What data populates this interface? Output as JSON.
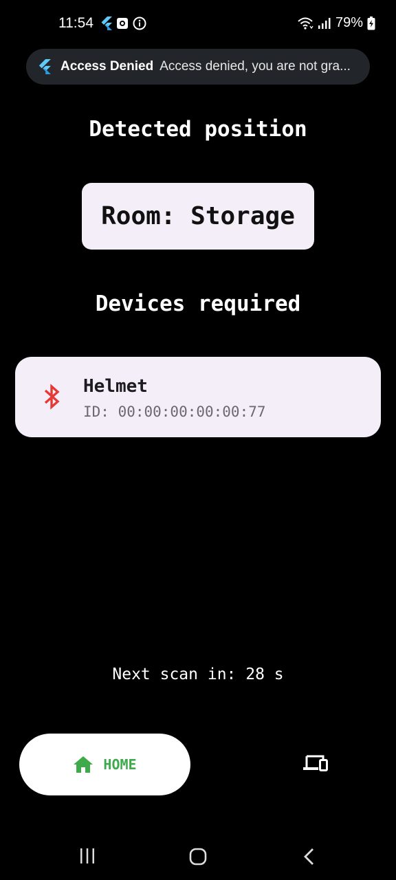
{
  "status_bar": {
    "time": "11:54",
    "battery": "79%",
    "left_icons": [
      "flutter-icon",
      "record-icon",
      "info-icon"
    ],
    "right_icons": [
      "wifi-icon",
      "signal-icon",
      "battery-charging-icon"
    ]
  },
  "notification": {
    "app_icon": "flutter-icon",
    "title": "Access Denied",
    "text": "Access denied, you are not gra..."
  },
  "position": {
    "heading": "Detected position",
    "room": "Room: Storage"
  },
  "devices": {
    "heading": "Devices required",
    "items": [
      {
        "icon": "bluetooth-icon",
        "name": "Helmet",
        "id": "ID: 00:00:00:00:00:77"
      }
    ]
  },
  "scan": {
    "text": "Next scan in: 28 s"
  },
  "bottom_nav": {
    "home_label": "HOME",
    "home_icon": "home-icon",
    "devices_icon": "devices-icon"
  },
  "colors": {
    "background": "#000000",
    "card": "#f3eef7",
    "accent_green": "#3eaa4b",
    "bluetooth_red": "#e53935",
    "notification_bg": "#22262b"
  }
}
